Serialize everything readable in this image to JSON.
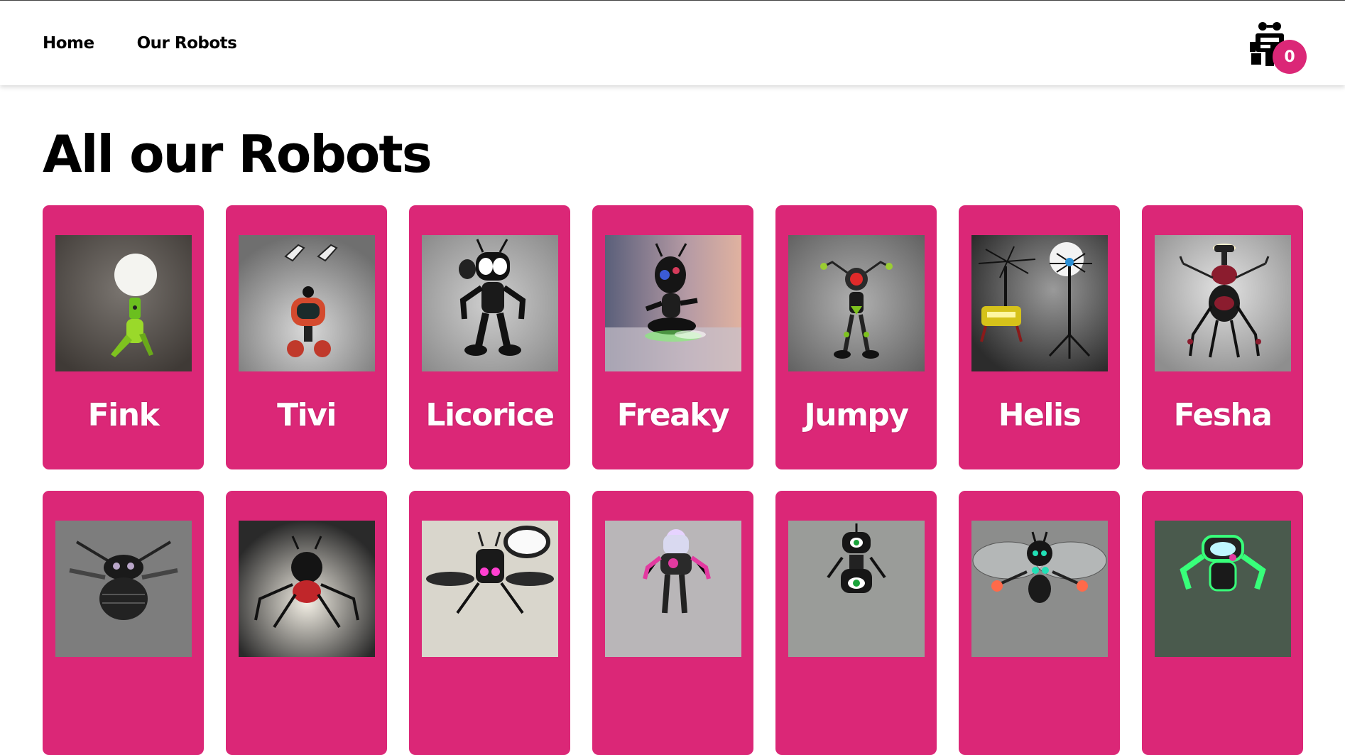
{
  "nav": {
    "home_label": "Home",
    "robots_label": "Our Robots"
  },
  "cart": {
    "icon": "robot-icon",
    "count": "0"
  },
  "page": {
    "title": "All our Robots"
  },
  "colors": {
    "accent": "#db2777"
  },
  "robots": [
    {
      "name": "Fink",
      "bg": "#6e6a66",
      "motif": "lamp-bulb"
    },
    {
      "name": "Tivi",
      "bg": "#8d8d8d",
      "motif": "tv-head"
    },
    {
      "name": "Licorice",
      "bg": "#a5a5a5",
      "motif": "black-robot"
    },
    {
      "name": "Freaky",
      "bg": "#8a7f93",
      "motif": "glow-robot"
    },
    {
      "name": "Jumpy",
      "bg": "#8e8e8e",
      "motif": "red-eye"
    },
    {
      "name": "Helis",
      "bg": "#5f5f5f",
      "motif": "helicopter"
    },
    {
      "name": "Fesha",
      "bg": "#a9a9a9",
      "motif": "lamp-walker"
    },
    {
      "name": "",
      "bg": "#7d7d7d",
      "motif": "bug"
    },
    {
      "name": "",
      "bg": "#c7c2b8",
      "motif": "spider"
    },
    {
      "name": "",
      "bg": "#d9d6cc",
      "motif": "fly-lamp"
    },
    {
      "name": "",
      "bg": "#b9b6b8",
      "motif": "pink-robot"
    },
    {
      "name": "",
      "bg": "#9a9c99",
      "motif": "cyclops"
    },
    {
      "name": "",
      "bg": "#8c8d8c",
      "motif": "dragonfly"
    },
    {
      "name": "",
      "bg": "#4a5a4d",
      "motif": "neon-green"
    }
  ]
}
